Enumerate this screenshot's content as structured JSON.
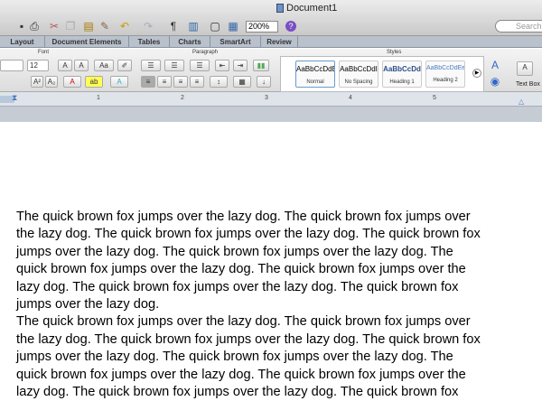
{
  "window": {
    "title": "Document1"
  },
  "toolbar": {
    "zoom": "200%",
    "search_placeholder": "Search",
    "help": "?",
    "pilcrow": "¶"
  },
  "tabs": [
    "Layout",
    "Document Elements",
    "Tables",
    "Charts",
    "SmartArt",
    "Review"
  ],
  "ribbon": {
    "font_group": "Font",
    "paragraph_group": "Paragraph",
    "styles_group": "Styles",
    "font_size": "12",
    "styles": [
      {
        "sample": "AaBbCcDdE",
        "name": "Normal"
      },
      {
        "sample": "AaBbCcDdI",
        "name": "No Spacing"
      },
      {
        "sample": "AaBbCcDd",
        "name": "Heading 1"
      },
      {
        "sample": "AaBbCcDdEe",
        "name": "Heading 2"
      }
    ],
    "text_box": "Text Box"
  },
  "ruler": [
    "1",
    "2",
    "3",
    "4",
    "5"
  ],
  "document": {
    "lines": [
      "The quick brown fox jumps over the lazy dog.  The quick brown fox jumps over",
      "the lazy dog.  The quick brown fox jumps over the lazy dog.  The quick brown fox",
      "jumps over the lazy dog.  The quick brown fox jumps over the lazy dog.  The",
      "quick brown fox jumps over the lazy dog.  The quick brown fox jumps over the",
      "lazy dog.  The quick brown fox jumps over the lazy dog.  The quick brown fox",
      "jumps over the lazy dog.",
      "The quick brown fox jumps over the lazy dog.  The quick brown fox jumps over",
      "the lazy dog.  The quick brown fox jumps over the lazy dog.  The quick brown fox",
      "jumps over the lazy dog.  The quick brown fox jumps over the lazy dog.  The",
      "quick brown fox jumps over the lazy dog.  The quick brown fox jumps over the",
      "lazy dog.  The quick brown fox jumps over the lazy dog.  The quick brown fox"
    ]
  }
}
